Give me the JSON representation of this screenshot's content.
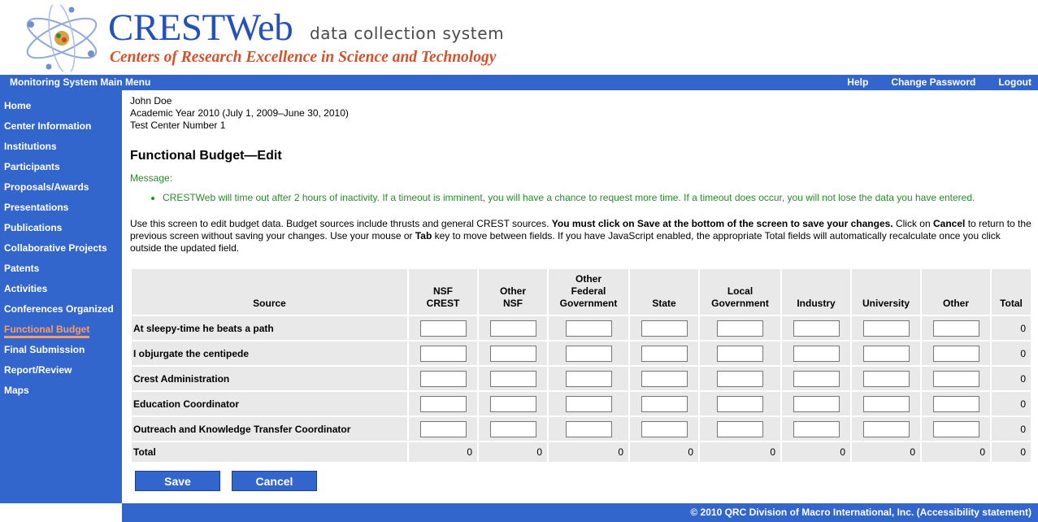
{
  "header": {
    "brand": "CRESTWeb",
    "brand_sub": "data collection system",
    "tagline": "Centers of Research Excellence in Science and Technology"
  },
  "topbar": {
    "menu_title": "Monitoring System Main Menu",
    "help": "Help",
    "change_password": "Change Password",
    "logout": "Logout"
  },
  "sidebar": {
    "items": [
      {
        "label": "Home"
      },
      {
        "label": "Center Information"
      },
      {
        "label": "Institutions"
      },
      {
        "label": "Participants"
      },
      {
        "label": "Proposals/Awards"
      },
      {
        "label": "Presentations"
      },
      {
        "label": "Publications"
      },
      {
        "label": "Collaborative Projects"
      },
      {
        "label": "Patents"
      },
      {
        "label": "Activities"
      },
      {
        "label": "Conferences Organized"
      },
      {
        "label": "Functional Budget"
      },
      {
        "label": "Final Submission"
      },
      {
        "label": "Report/Review"
      },
      {
        "label": "Maps"
      }
    ],
    "active_index": 11
  },
  "main": {
    "user_name": "John Doe",
    "academic_year": "Academic Year 2010 (July 1, 2009–June 30, 2010)",
    "center": "Test Center Number 1",
    "title": "Functional Budget—Edit",
    "message_label": "Message:",
    "message": "CRESTWeb will time out after 2 hours of inactivity. If a timeout is imminent, you will have a chance to request more time. If a timeout does occur, you will not lose the data you have entered.",
    "instructions": {
      "part1": "Use this screen to edit budget data. Budget sources include thrusts and general CREST sources. ",
      "bold1": "You must click on Save at the bottom of the screen to save your changes.",
      "part2": " Click on ",
      "bold2": "Cancel",
      "part3": " to return to the previous screen without saving your changes. Use your mouse or ",
      "bold3": "Tab",
      "part4": " key to move between fields. If you have JavaScript enabled, the appropriate Total fields will automatically recalculate once you click outside the updated field."
    }
  },
  "table": {
    "headers": {
      "source": "Source",
      "nsf_crest": [
        "NSF",
        "CREST"
      ],
      "other_nsf": [
        "Other",
        "NSF"
      ],
      "other_federal": [
        "Other",
        "Federal",
        "Government"
      ],
      "state": "State",
      "local": [
        "Local",
        "Government"
      ],
      "industry": "Industry",
      "university": "University",
      "other": "Other",
      "total": "Total"
    },
    "rows": [
      {
        "source": "At sleepy-time he beats a path",
        "values": [
          "",
          "",
          "",
          "",
          "",
          "",
          "",
          ""
        ],
        "total": "0"
      },
      {
        "source": "I objurgate the centipede",
        "values": [
          "",
          "",
          "",
          "",
          "",
          "",
          "",
          ""
        ],
        "total": "0"
      },
      {
        "source": "Crest Administration",
        "values": [
          "",
          "",
          "",
          "",
          "",
          "",
          "",
          ""
        ],
        "total": "0"
      },
      {
        "source": "Education Coordinator",
        "values": [
          "",
          "",
          "",
          "",
          "",
          "",
          "",
          ""
        ],
        "total": "0"
      },
      {
        "source": "Outreach and Knowledge Transfer Coordinator",
        "values": [
          "",
          "",
          "",
          "",
          "",
          "",
          "",
          ""
        ],
        "total": "0"
      }
    ],
    "total_row": {
      "label": "Total",
      "values": [
        "0",
        "0",
        "0",
        "0",
        "0",
        "0",
        "0",
        "0",
        "0"
      ]
    }
  },
  "buttons": {
    "save": "Save",
    "cancel": "Cancel"
  },
  "footer": {
    "text": "© 2010 QRC Division of Macro International, Inc. (Accessibility statement)"
  },
  "colors": {
    "nav_blue": "#3366cc",
    "brand_blue": "#2552b8",
    "tagline_orange": "#d0532b",
    "message_green": "#2a8a2a",
    "active_orange": "#ff9966"
  }
}
